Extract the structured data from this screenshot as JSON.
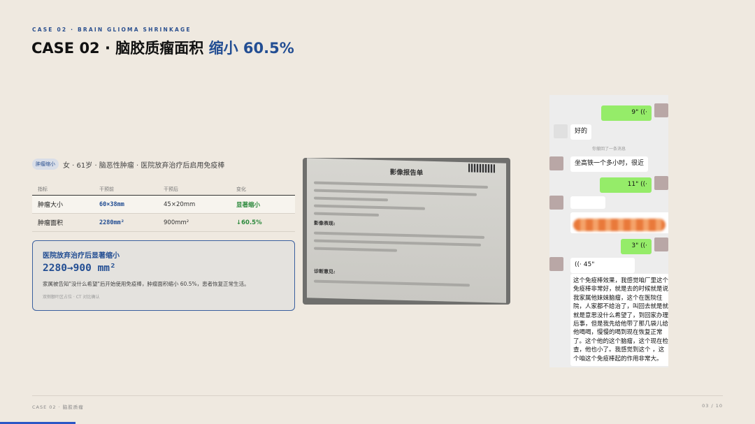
{
  "header": {
    "eyebrow": "CASE 02 · BRAIN GLIOMA SHRINKAGE",
    "title_main": "CASE 02 · 脑胶质瘤面积",
    "title_accent": "缩小 60.5%"
  },
  "patient": {
    "tag": "肿瘤缩小",
    "summary": "女 · 61岁 · 脑恶性肿瘤 · 医院放弃治疗后启用免疫棒"
  },
  "table": {
    "headers": [
      "指标",
      "干预前",
      "干预后",
      "变化"
    ],
    "rows": [
      [
        "肿瘤大小",
        "60×38mm",
        "45×20mm",
        "显著缩小"
      ],
      [
        "肿瘤面积",
        "2280mm²",
        "900mm²",
        "↓60.5%"
      ]
    ]
  },
  "card": {
    "title": "医院放弃治疗后显著缩小",
    "value": "2280→900 mm²",
    "desc": "家属被告知\"没什么希望\"后开始使用免疫棒，肿瘤面积缩小 60.5%，患者恢复正常生活。",
    "note": "双侧额叶区占位 · CT 对比确认"
  },
  "report": {
    "title": "影像报告单",
    "sec1": "影像表现:",
    "sec2": "诊断意见:"
  },
  "chat": {
    "msg1": "9\" ((·",
    "msg2": "好的",
    "system": "你撤回了一条消息",
    "msg3": "坐高铁一个多小时，很近",
    "msg4": "11\" ((·",
    "msg5": "3\" ((·",
    "msg6": "((· 45\"",
    "msg7": "这个免疫棒效果，我感觉咱厂里这个免疫棒非常好，就是去的时候就是说我家属他妹妹脑瘤，这个在医院住院，人家都不给治了，叫回去就是就就是意思没什么希望了，到回家办理后事，但是我先给他带了那几袋儿给他喝喝，慢慢的喝到现在恢复正常了。这个他的这个脑瘤，这个现在检查，他也小了。我感觉到这个 ，这个咱这个免疫棒起的作用非常大。"
  },
  "footer": {
    "left": "CASE 02 · 脑胶质瘤",
    "right": "03 / 10"
  },
  "progress": {
    "fraction": 0.1
  },
  "colors": {
    "accent": "#234e93",
    "green": "#2e8a3e",
    "progress": "#2a57c6"
  }
}
